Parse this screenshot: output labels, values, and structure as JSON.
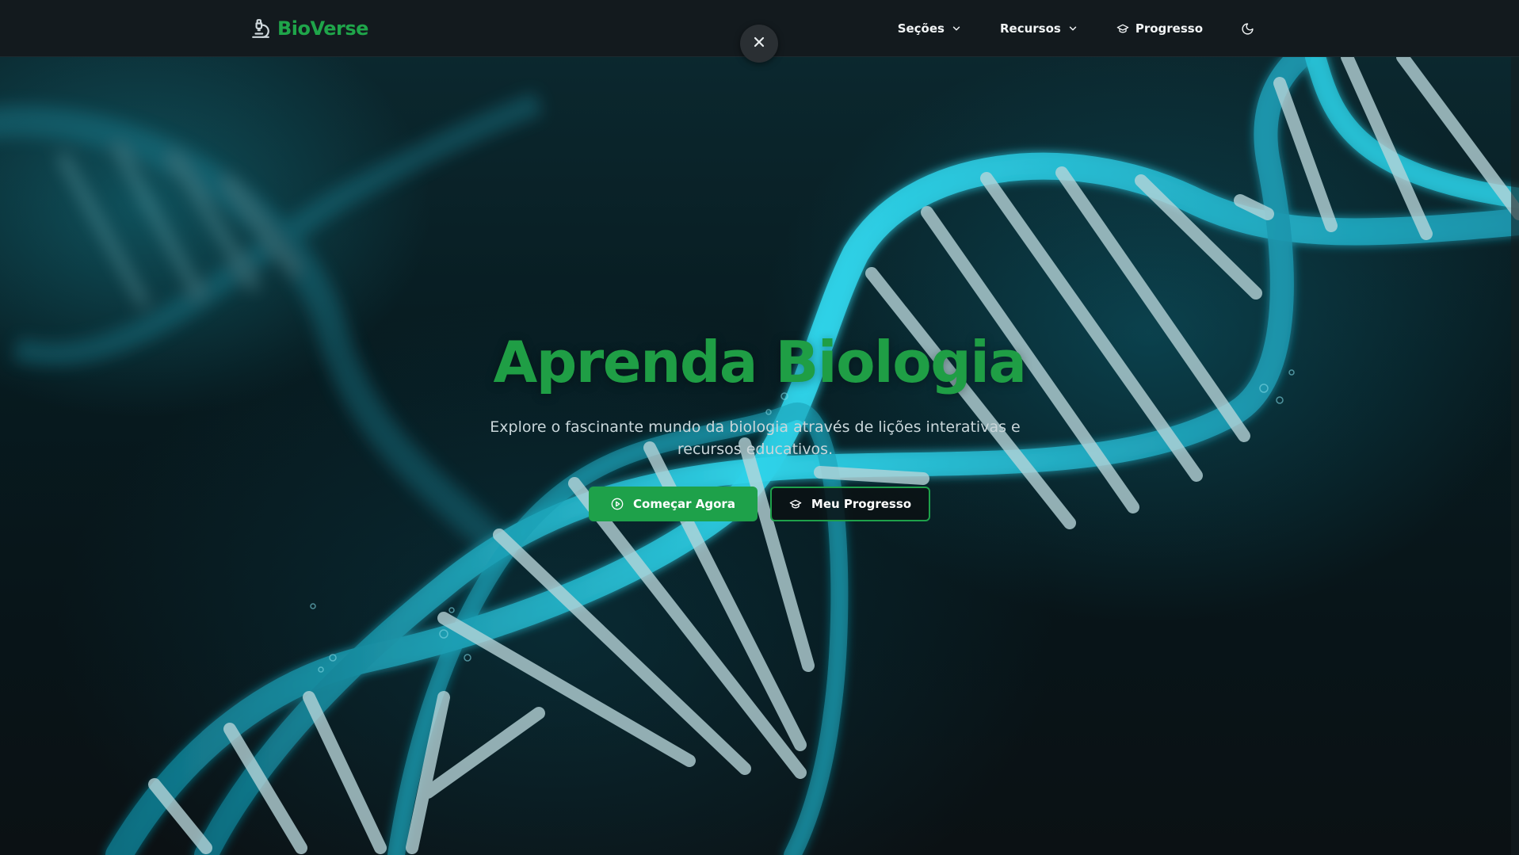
{
  "brand": {
    "name": "BioVerse",
    "icon": "microscope-icon",
    "color": "#1fa54a"
  },
  "nav": {
    "sections_label": "Seções",
    "resources_label": "Recursos",
    "progress_label": "Progresso",
    "theme_icon": "moon-icon"
  },
  "overlay": {
    "close_icon": "close-icon"
  },
  "hero": {
    "title": "Aprenda Biologia",
    "subtitle": "Explore o fascinante mundo da biologia através de lições interativas e recursos educativos.",
    "primary_button": "Começar Agora",
    "secondary_button": "Meu Progresso",
    "background": "dna-double-helix-image"
  },
  "colors": {
    "accent": "#1ea14a",
    "navbar": "#131a1e",
    "helix": "#25c6dc"
  }
}
